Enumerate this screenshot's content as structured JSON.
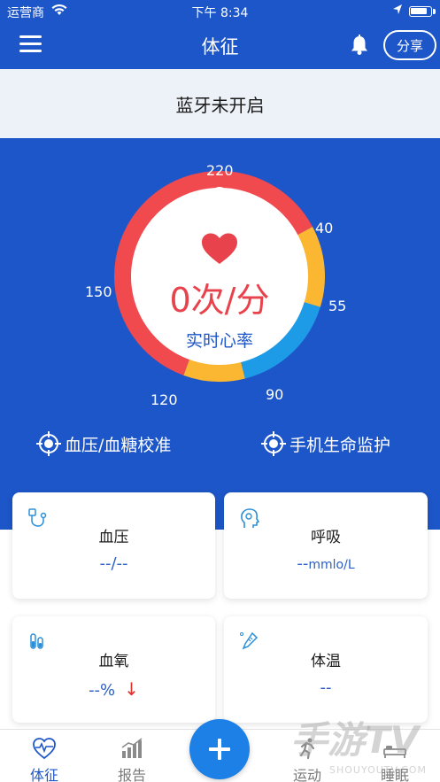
{
  "status_bar": {
    "carrier": "运营商",
    "time": "下午 8:34"
  },
  "navbar": {
    "title": "体征",
    "share_label": "分享"
  },
  "bluetooth_banner": "蓝牙未开启",
  "gauge": {
    "labels": {
      "top": "220",
      "upper_right": "40",
      "right": "55",
      "lower_right": "90",
      "lower_left": "120",
      "left": "150"
    },
    "heart_rate_value": "0次/分",
    "heart_rate_label": "实时心率",
    "colors": {
      "red": "#f04a4f",
      "yellow": "#fbb731",
      "blue": "#1e9be6"
    }
  },
  "actions": {
    "calibrate": "血压/血糖校准",
    "monitor": "手机生命监护"
  },
  "cards": {
    "blood_pressure": {
      "title": "血压",
      "value": "--/--"
    },
    "respiration": {
      "title": "呼吸",
      "value": "--",
      "unit": "mmlo/L"
    },
    "blood_oxygen": {
      "title": "血氧",
      "value": "--%",
      "trend_icon": "arrow-down-icon"
    },
    "temperature": {
      "title": "体温",
      "value": "--"
    }
  },
  "tabs": {
    "vitals": "体征",
    "report": "报告",
    "exercise": "运动",
    "sleep": "睡眠"
  },
  "watermark": {
    "main": "手游TV",
    "sub": "SHOUYOUTV.COM"
  },
  "accent_color": "#1d56c8"
}
